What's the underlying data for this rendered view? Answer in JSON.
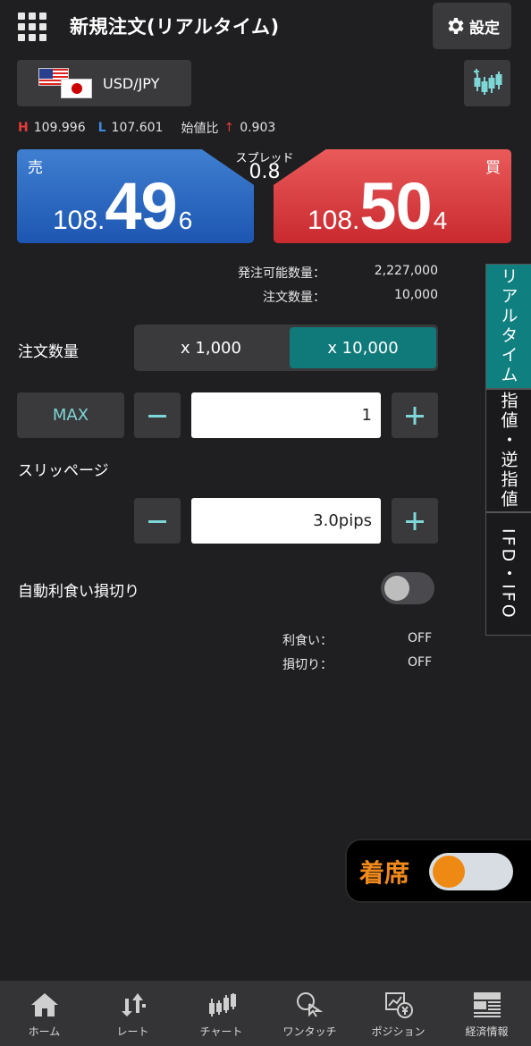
{
  "header": {
    "title": "新規注文(リアルタイム)",
    "settings_label": "設定"
  },
  "pair": {
    "label": "USD/JPY"
  },
  "highlow": {
    "h_label": "H",
    "high": "109.996",
    "l_label": "L",
    "low": "107.601",
    "change_label": "始値比",
    "change_arrow": "↑",
    "change": "0.903"
  },
  "sell": {
    "label": "売",
    "base": "108.",
    "big": "49",
    "small": "6"
  },
  "buy": {
    "label": "買",
    "base": "108.",
    "big": "50",
    "small": "4"
  },
  "spread": {
    "label": "スプレッド",
    "value": "0.8"
  },
  "info": {
    "available_label": "発注可能数量：",
    "available_value": "2,227,000",
    "qty_label": "注文数量：",
    "qty_value": "10,000"
  },
  "quantity": {
    "label": "注文数量",
    "option_a": "x 1,000",
    "option_b": "x 10,000",
    "max_label": "MAX",
    "value": "1"
  },
  "slippage": {
    "label": "スリッページ",
    "value": "3.0pips"
  },
  "auto_tp_sl": {
    "label": "自動利食い損切り",
    "take_profit_label": "利食い：",
    "take_profit_value": "OFF",
    "stop_loss_label": "損切り：",
    "stop_loss_value": "OFF"
  },
  "side_tabs": {
    "realtime": "リアルタイム",
    "limit_stop": "指値・逆指値",
    "ifd_ifo": "IFD・IFO"
  },
  "attendance": {
    "label": "着席"
  },
  "nav": [
    {
      "label": "ホーム",
      "icon": "home-icon"
    },
    {
      "label": "レート",
      "icon": "rate-icon"
    },
    {
      "label": "チャート",
      "icon": "chart-icon"
    },
    {
      "label": "ワンタッチ",
      "icon": "one-touch-icon"
    },
    {
      "label": "ポジション",
      "icon": "position-icon"
    },
    {
      "label": "経済情報",
      "icon": "news-icon"
    }
  ],
  "colors": {
    "background": "#1f1e21",
    "sell": "#1d56b2",
    "buy": "#c92a2f",
    "accent": "#107a7a",
    "attend": "#ee8a13"
  }
}
